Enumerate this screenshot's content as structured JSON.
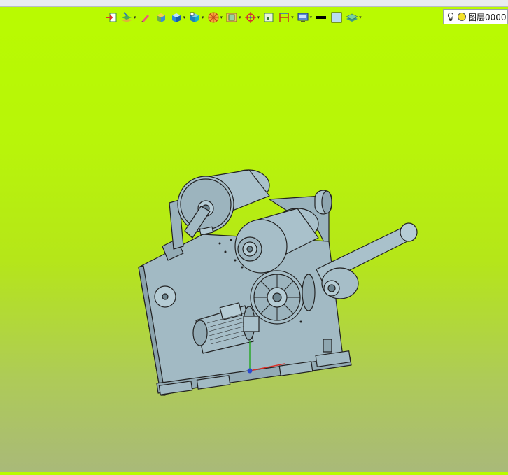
{
  "app": {
    "toolbar": {
      "buttons": [
        {
          "icon": "import-icon",
          "dropdown": false
        },
        {
          "icon": "sketch-layers-icon",
          "dropdown": true
        },
        {
          "icon": "pen-icon",
          "dropdown": false
        },
        {
          "icon": "solid-box-icon",
          "dropdown": false
        },
        {
          "icon": "box-view-icon",
          "dropdown": true
        },
        {
          "icon": "cube-face-icon",
          "dropdown": true
        },
        {
          "icon": "wheel-icon",
          "dropdown": true
        },
        {
          "icon": "section-view-icon",
          "dropdown": true
        },
        {
          "icon": "origin-target-icon",
          "dropdown": true
        },
        {
          "icon": "frame-icon",
          "dropdown": false
        },
        {
          "icon": "dimension-icon",
          "dropdown": true
        },
        {
          "icon": "display-icon",
          "dropdown": true
        },
        {
          "icon": "line-color-icon",
          "dropdown": false
        },
        {
          "icon": "fill-color-icon",
          "dropdown": false
        },
        {
          "icon": "layers-icon",
          "dropdown": true
        }
      ],
      "dropdown_glyph": "▾"
    },
    "layer": {
      "value": "图层0000",
      "icons": [
        "lightbulb-icon",
        "layer-color-icon"
      ]
    },
    "viewport": {
      "background_top": "#b9fb00",
      "background_bottom": "#a9b979",
      "model_color": "#a2bac4",
      "model_name": "machine-assembly-model"
    }
  }
}
